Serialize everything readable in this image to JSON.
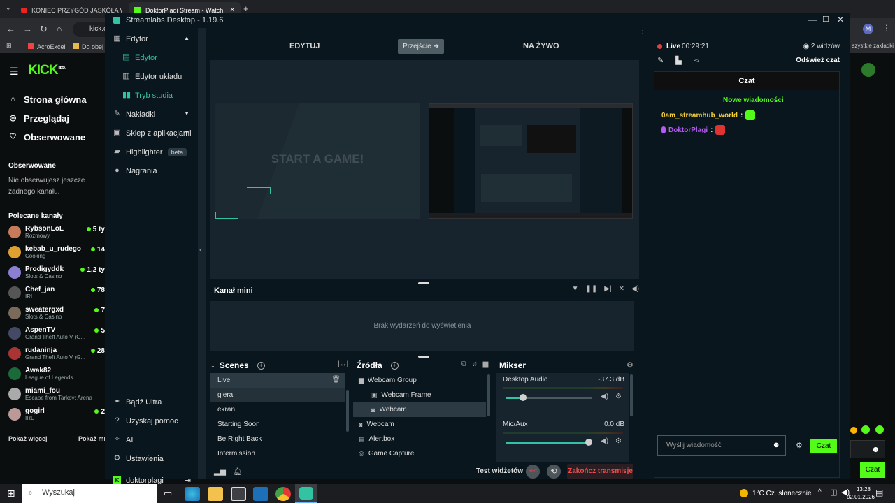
{
  "browser": {
    "tabs": [
      {
        "label": "KONIEC PRZYGÓD JASKÓŁA W..."
      },
      {
        "label": "DoktorPlagi Stream - Watch"
      }
    ],
    "address": "kick.co",
    "bookmarks": [
      "AcroExcel",
      "Do obej"
    ],
    "bookmarks_right": "Wszystkie zakładki"
  },
  "kick": {
    "logo": "KICK",
    "logo_badge": "BETA",
    "nav": [
      {
        "label": "Strona główna",
        "icon": "home-icon"
      },
      {
        "label": "Przeglądaj",
        "icon": "compass-icon"
      },
      {
        "label": "Obserwowane",
        "icon": "heart-icon"
      }
    ],
    "followed_title": "Obserwowane",
    "followed_empty": "Nie obserwujesz jeszcze żadnego kanału.",
    "recommended_title": "Polecane kanały",
    "channels": [
      {
        "name": "RybsonLoL",
        "category": "Rozmowy",
        "viewers": "5 ty",
        "color": "#c77b5a"
      },
      {
        "name": "kebab_u_rudego",
        "category": "Cooking",
        "viewers": "14",
        "color": "#e0a030"
      },
      {
        "name": "Prodigyddk",
        "category": "Slots & Casino",
        "viewers": "1,2 ty",
        "color": "#8a7fd0"
      },
      {
        "name": "Chef_jan",
        "category": "IRL",
        "viewers": "78",
        "color": "#555"
      },
      {
        "name": "sweatergxd",
        "category": "Slots & Casino",
        "viewers": "7",
        "color": "#7a6a5a"
      },
      {
        "name": "AspenTV",
        "category": "Grand Theft Auto V (G...",
        "viewers": "5",
        "color": "#444a66"
      },
      {
        "name": "rudaninja",
        "category": "Grand Theft Auto V (G...",
        "viewers": "28",
        "color": "#a33"
      },
      {
        "name": "Awak82",
        "category": "League of Legends",
        "viewers": "",
        "color": "#1a6a3a"
      },
      {
        "name": "miami_fou",
        "category": "Escape from Tarkov: Arena",
        "viewers": "",
        "color": "#aaa"
      },
      {
        "name": "gogirl",
        "category": "IRL",
        "viewers": "2",
        "color": "#b99"
      }
    ],
    "show_more": "Pokaż więcej",
    "show_more2": "Pokaż mn",
    "chat_button": "Czat"
  },
  "streamlabs": {
    "title": "Streamlabs Desktop - 1.19.6",
    "side": {
      "editor": "Edytor",
      "editor_sub": [
        "Edytor",
        "Edytor układu",
        "Tryb studia"
      ],
      "overlays": "Nakładki",
      "appstore": "Sklep z aplikacjami",
      "highlighter": "Highlighter",
      "highlighter_badge": "beta",
      "recordings": "Nagrania",
      "ultra": "Bądź Ultra",
      "help": "Uzyskaj pomoc",
      "ai": "AI",
      "settings": "Ustawienia",
      "user": "doktorplagi"
    },
    "studio": {
      "edit_label": "EDYTUJ",
      "transition_label": "Przejście",
      "live_label": "NA ŻYWO",
      "start_game": "START A GAME!"
    },
    "minifeed": {
      "title": "Kanał mini",
      "empty": "Brak wydarzeń do wyświetlenia"
    },
    "scenes": {
      "title": "Scenes",
      "items": [
        "Live",
        "giera",
        "ekran",
        "Starting Soon",
        "Be Right Back",
        "Intermission"
      ]
    },
    "sources": {
      "title": "Źródła",
      "items": [
        {
          "label": "Webcam Group",
          "icon": "folder-icon",
          "level": 0
        },
        {
          "label": "Webcam Frame",
          "icon": "image-icon",
          "level": 1
        },
        {
          "label": "Webcam",
          "icon": "webcam-icon",
          "level": 1
        },
        {
          "label": "Webcam",
          "icon": "webcam-icon",
          "level": 0
        },
        {
          "label": "Alertbox",
          "icon": "alert-icon",
          "level": 0
        },
        {
          "label": "Game Capture",
          "icon": "gamepad-icon",
          "level": 0
        }
      ]
    },
    "mixer": {
      "title": "Mikser",
      "channels": [
        {
          "name": "Desktop Audio",
          "db": "-37.3 dB",
          "level": 0.2
        },
        {
          "name": "Mic/Aux",
          "db": "0.0 dB",
          "level": 0.96
        }
      ]
    },
    "footer": {
      "test_widgets": "Test widżetów",
      "rec": "REC",
      "end_stream": "Zakończ transmisję"
    },
    "chat": {
      "live_label": "Live",
      "live_time": "00:29:21",
      "viewers": "2 widzów",
      "refresh": "Odśwież czat",
      "title": "Czat",
      "new_messages": "Nowe wiadomości",
      "messages": [
        {
          "user": "0am_streamhub_world",
          "color": "#f5d23a"
        },
        {
          "user": "DoktorPlagi",
          "color": "#b55bf2"
        }
      ],
      "input_placeholder": "Wyślij wiadomość",
      "send_label": "Czat"
    }
  },
  "taskbar": {
    "search": "Wyszukaj",
    "weather": "1°C  Cz. słonecznie",
    "time": "13:28",
    "date": "02.01.2026"
  }
}
